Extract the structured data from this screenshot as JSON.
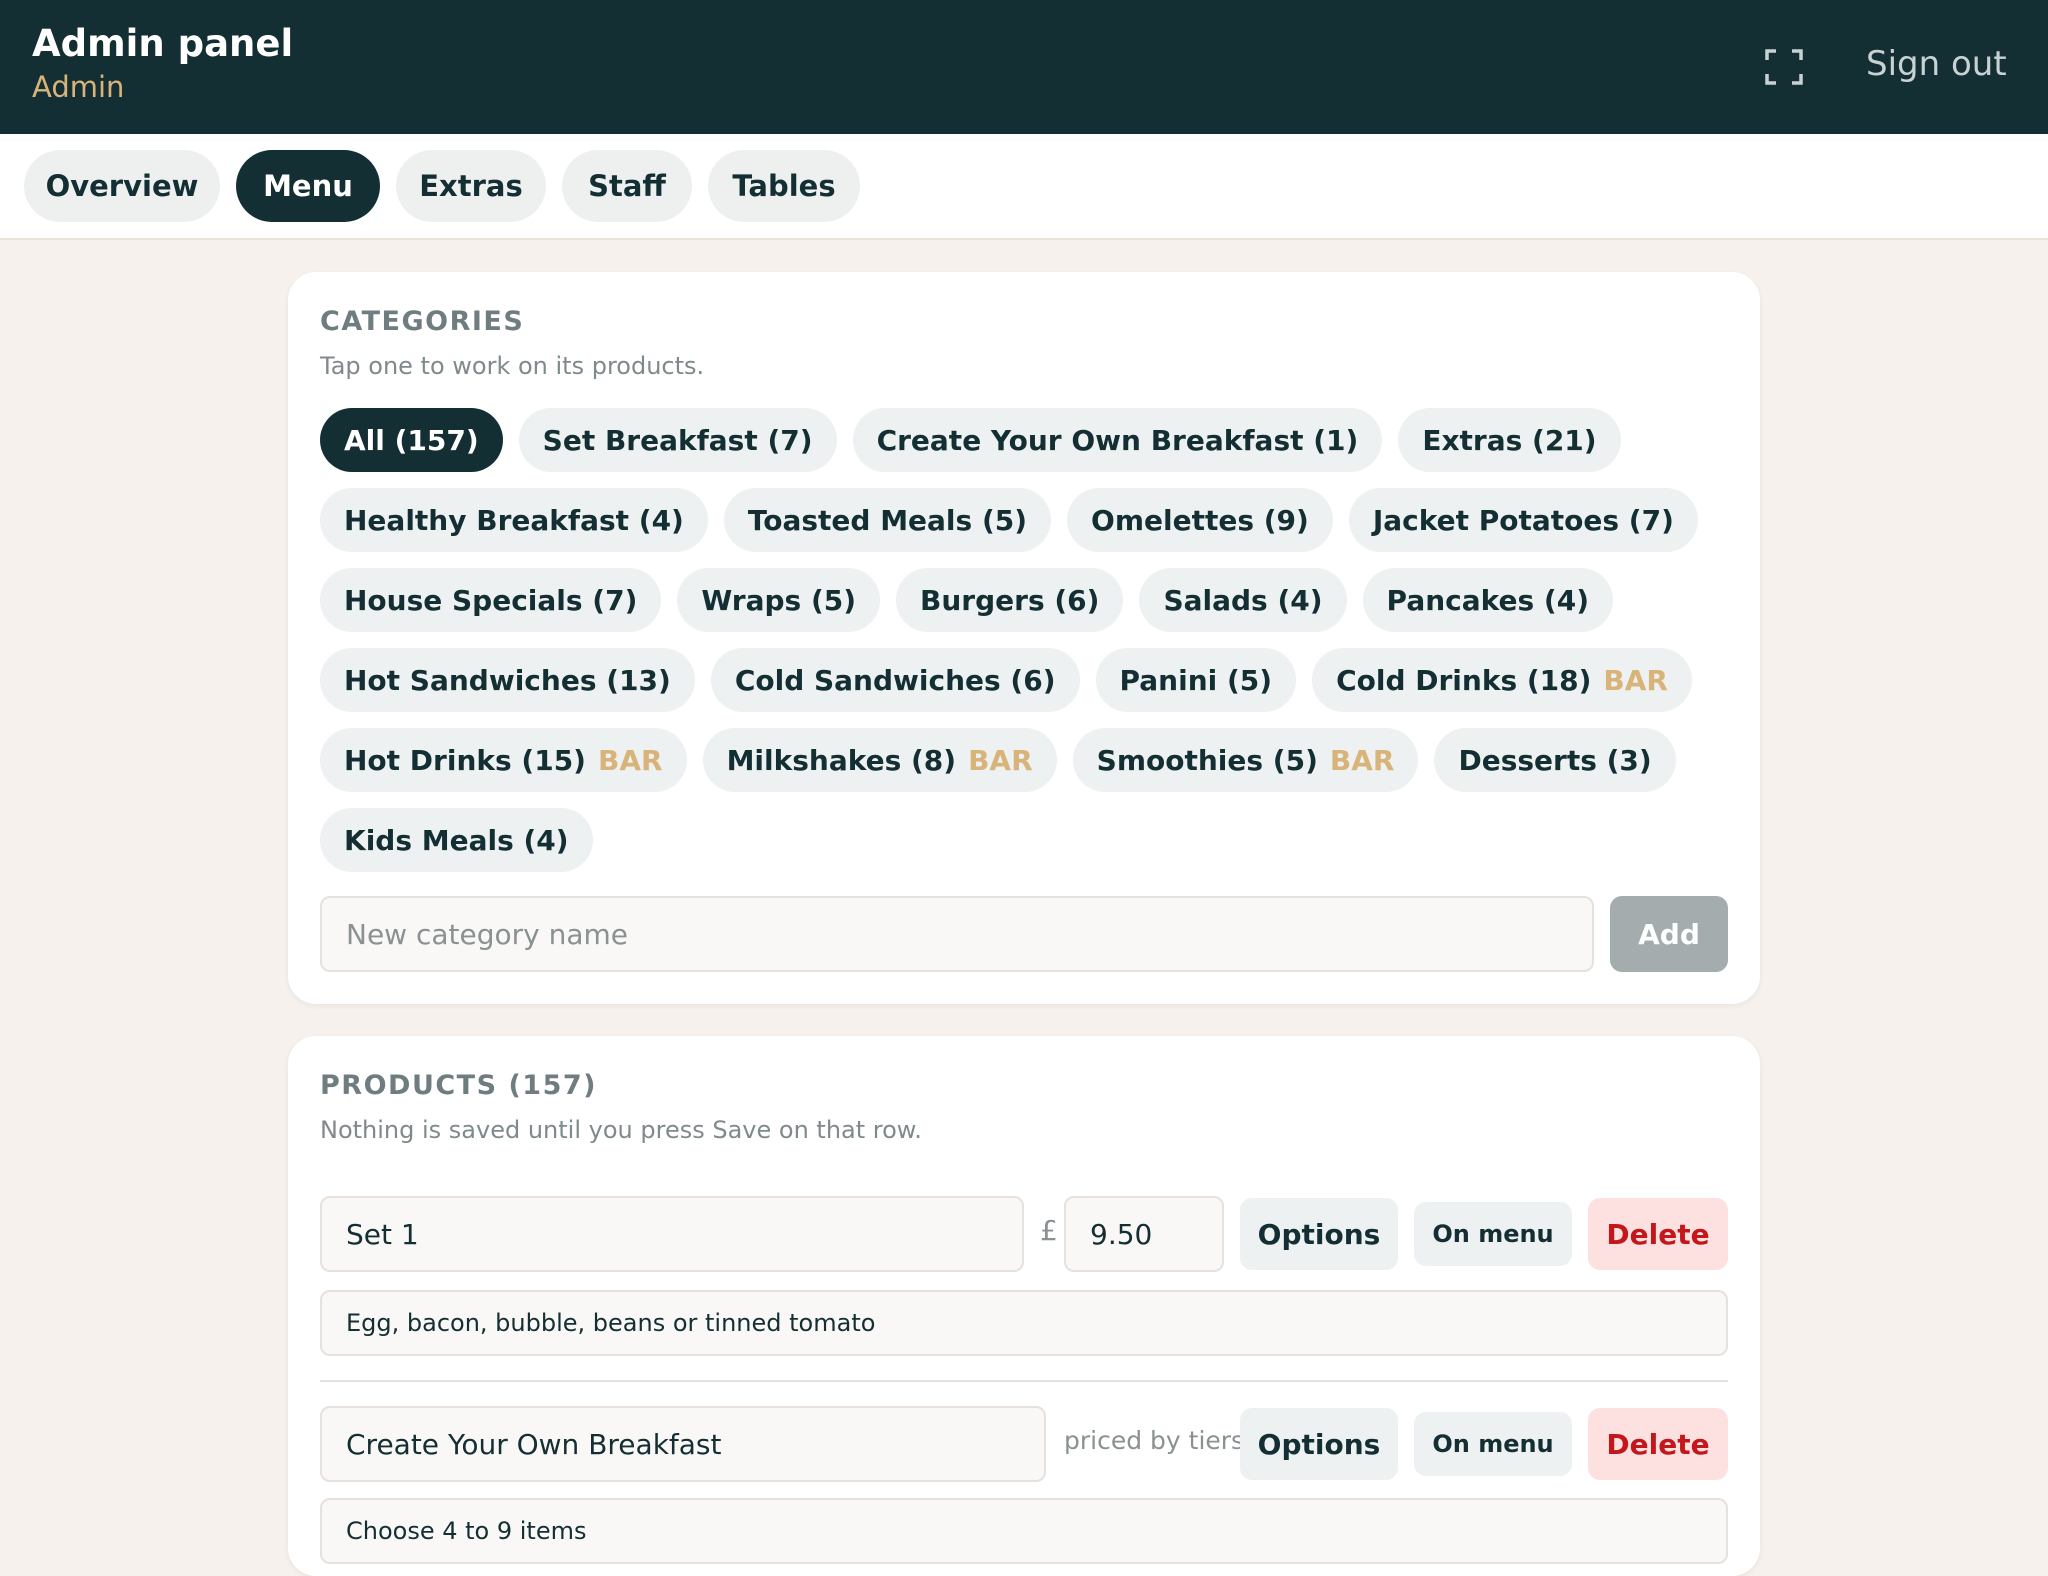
{
  "header": {
    "title": "Admin panel",
    "role": "Admin",
    "fullscreen_icon": "fullscreen-icon",
    "sign_out_label": "Sign out"
  },
  "tabs": [
    {
      "label": "Overview",
      "active": false
    },
    {
      "label": "Menu",
      "active": true
    },
    {
      "label": "Extras",
      "active": false
    },
    {
      "label": "Staff",
      "active": false
    },
    {
      "label": "Tables",
      "active": false
    }
  ],
  "categories": {
    "heading": "CATEGORIES",
    "subtitle": "Tap one to work on its products.",
    "items": [
      {
        "label": "All (157)",
        "active": true,
        "badge": ""
      },
      {
        "label": "Set Breakfast (7)",
        "active": false,
        "badge": ""
      },
      {
        "label": "Create Your Own Breakfast (1)",
        "active": false,
        "badge": ""
      },
      {
        "label": "Extras (21)",
        "active": false,
        "badge": ""
      },
      {
        "label": "Healthy Breakfast (4)",
        "active": false,
        "badge": ""
      },
      {
        "label": "Toasted Meals (5)",
        "active": false,
        "badge": ""
      },
      {
        "label": "Omelettes (9)",
        "active": false,
        "badge": ""
      },
      {
        "label": "Jacket Potatoes (7)",
        "active": false,
        "badge": ""
      },
      {
        "label": "House Specials (7)",
        "active": false,
        "badge": ""
      },
      {
        "label": "Wraps (5)",
        "active": false,
        "badge": ""
      },
      {
        "label": "Burgers (6)",
        "active": false,
        "badge": ""
      },
      {
        "label": "Salads (4)",
        "active": false,
        "badge": ""
      },
      {
        "label": "Pancakes (4)",
        "active": false,
        "badge": ""
      },
      {
        "label": "Hot Sandwiches (13)",
        "active": false,
        "badge": ""
      },
      {
        "label": "Cold Sandwiches (6)",
        "active": false,
        "badge": ""
      },
      {
        "label": "Panini (5)",
        "active": false,
        "badge": ""
      },
      {
        "label": "Cold Drinks (18)",
        "active": false,
        "badge": "BAR"
      },
      {
        "label": "Hot Drinks (15)",
        "active": false,
        "badge": "BAR"
      },
      {
        "label": "Milkshakes (8)",
        "active": false,
        "badge": "BAR"
      },
      {
        "label": "Smoothies (5)",
        "active": false,
        "badge": "BAR"
      },
      {
        "label": "Desserts (3)",
        "active": false,
        "badge": ""
      },
      {
        "label": "Kids Meals (4)",
        "active": false,
        "badge": ""
      }
    ],
    "new_placeholder": "New category name",
    "new_value": "",
    "add_label": "Add"
  },
  "products": {
    "heading": "PRODUCTS (157)",
    "subtitle": "Nothing is saved until you press Save on that row.",
    "currency_symbol": "£",
    "options_label": "Options",
    "on_menu_label": "On menu",
    "delete_label": "Delete",
    "rows": [
      {
        "name": "Set 1",
        "price": "9.50",
        "priced_by_tiers": "",
        "description": "Egg, bacon, bubble, beans or tinned tomato"
      },
      {
        "name": "Create Your Own Breakfast",
        "price": "",
        "priced_by_tiers": "priced by tiers",
        "description": "Choose 4 to 9 items"
      }
    ]
  },
  "colors": {
    "primary": "#142f33",
    "accent": "#d9b47a",
    "background": "#f6f1ec",
    "delete_text": "#c4171b",
    "delete_bg": "#fde1e1"
  }
}
